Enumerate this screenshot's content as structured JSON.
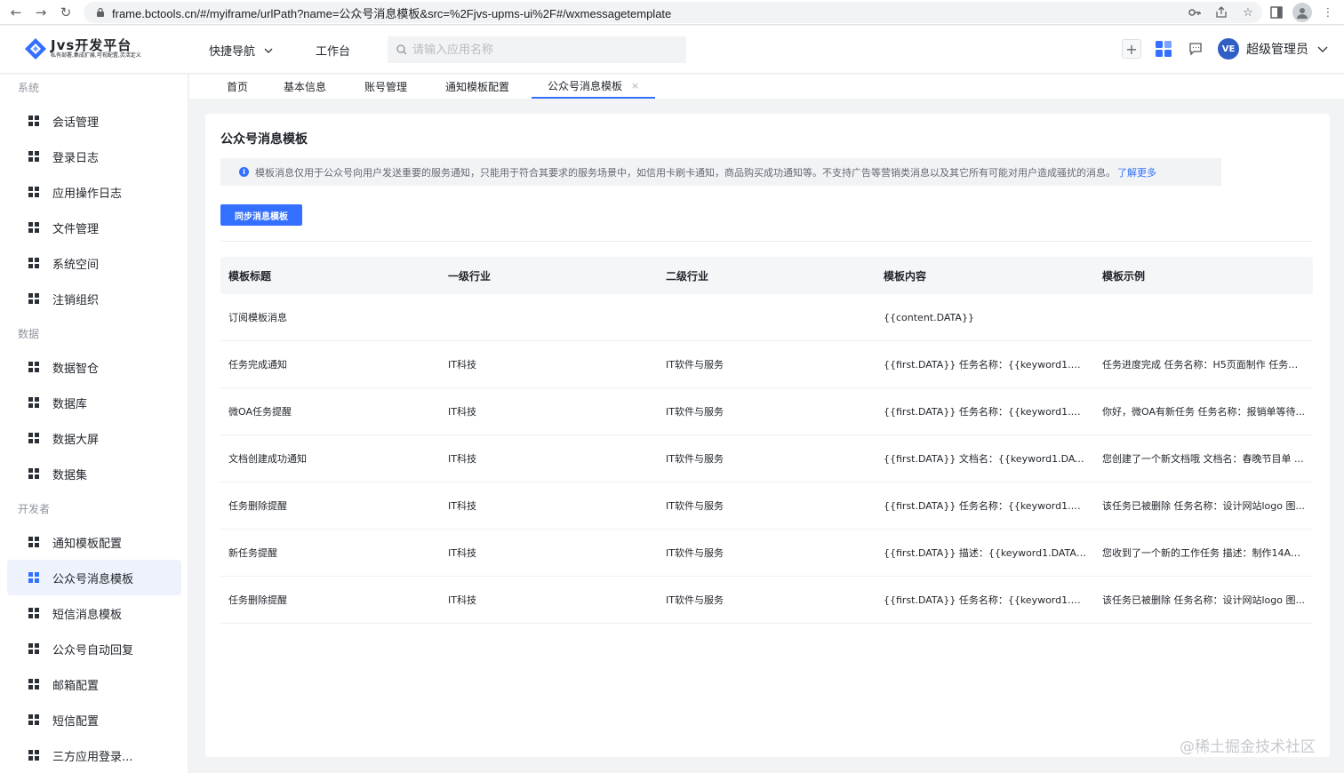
{
  "browser": {
    "url": "frame.bctools.cn/#/myiframe/urlPath?name=公众号消息模板&src=%2Fjvs-upms-ui%2F#/wxmessagetemplate"
  },
  "header": {
    "logo_title": "Jvs开发平台",
    "logo_subtitle": "私有部署,集成扩展,可视配置,灵活定义",
    "quick_nav": "快捷导航",
    "workbench": "工作台",
    "search_placeholder": "请输入应用名称",
    "avatar_text": "VE",
    "username": "超级管理员"
  },
  "sidebar": {
    "groups": [
      {
        "label": "系统",
        "items": [
          "会话管理",
          "登录日志",
          "应用操作日志",
          "文件管理",
          "系统空间",
          "注销组织"
        ]
      },
      {
        "label": "数据",
        "items": [
          "数据智仓",
          "数据库",
          "数据大屏",
          "数据集"
        ]
      },
      {
        "label": "开发者",
        "items": [
          "通知模板配置",
          "公众号消息模板",
          "短信消息模板",
          "公众号自动回复",
          "邮箱配置",
          "短信配置",
          "三方应用登录..."
        ]
      }
    ],
    "active": "公众号消息模板"
  },
  "tabs": [
    "首页",
    "基本信息",
    "账号管理",
    "通知模板配置",
    "公众号消息模板"
  ],
  "tab_close": "×",
  "main": {
    "title": "公众号消息模板",
    "notice_icon": "i",
    "notice": "模板消息仅用于公众号向用户发送重要的服务通知，只能用于符合其要求的服务场景中，如信用卡刷卡通知，商品购买成功通知等。不支持广告等营销类消息以及其它所有可能对用户造成骚扰的消息。",
    "learn_more": "了解更多",
    "sync_button": "同步消息模板",
    "table": {
      "headers": [
        "模板标题",
        "一级行业",
        "二级行业",
        "模板内容",
        "模板示例"
      ],
      "rows": [
        [
          "订阅模板消息",
          "",
          "",
          "{{content.DATA}}",
          ""
        ],
        [
          "任务完成通知",
          "IT科技",
          "IT软件与服务",
          "{{first.DATA}} 任务名称：{{keyword1.DATA...",
          "任务进度完成 任务名称：H5页面制作 任务进..."
        ],
        [
          "微OA任务提醒",
          "IT科技",
          "IT软件与服务",
          "{{first.DATA}} 任务名称：{{keyword1.DATA...",
          "你好，微OA有新任务 任务名称：报销单等待..."
        ],
        [
          "文档创建成功通知",
          "IT科技",
          "IT软件与服务",
          "{{first.DATA}} 文档名：{{keyword1.DATA}} ...",
          "您创建了一个新文档哦 文档名：春晚节目单 ..."
        ],
        [
          "任务删除提醒",
          "IT科技",
          "IT软件与服务",
          "{{first.DATA}} 任务名称：{{keyword1.DATA...",
          "该任务已被删除 任务名称：设计网站logo 图..."
        ],
        [
          "新任务提醒",
          "IT科技",
          "IT软件与服务",
          "{{first.DATA}} 描述：{{keyword1.DATA}} 工...",
          "您收到了一个新的工作任务 描述：制作14A0..."
        ],
        [
          "任务删除提醒",
          "IT科技",
          "IT软件与服务",
          "{{first.DATA}} 任务名称：{{keyword1.DATA...",
          "该任务已被删除 任务名称：设计网站logo 图..."
        ]
      ]
    }
  },
  "watermark": "@稀土掘金技术社区",
  "colors": {
    "accent": "#3370ff",
    "active_bg": "#eef2fb"
  }
}
